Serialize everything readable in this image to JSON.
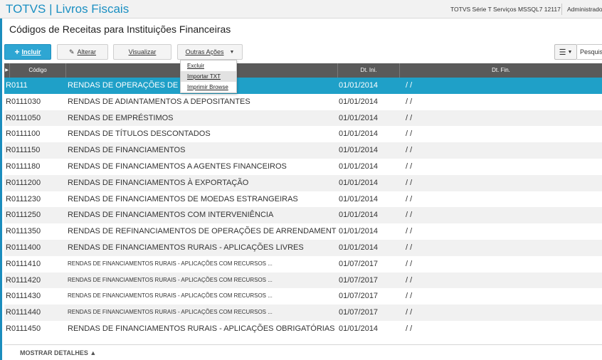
{
  "app": {
    "brand": "TOTVS | Livros Fiscais",
    "server": "TOTVS Série T Serviços MSSQL7 12117",
    "user": "Administrado"
  },
  "page": {
    "title": "Códigos de Receitas para Instituições Financeiras"
  },
  "toolbar": {
    "incluir": "Incluir",
    "alterar": "Alterar",
    "visualizar": "Visualizar",
    "outras": "Outras Ações",
    "search_label": "Pesquisa"
  },
  "menu": {
    "items": [
      "Excluir",
      "Importar TXT",
      "Imprimir Browse"
    ],
    "highlighted": 1
  },
  "grid": {
    "columns": [
      "Código",
      "",
      "Dt. Ini.",
      "Dt. Fin."
    ],
    "rows": [
      {
        "codigo": "R0111",
        "descricao": "RENDAS DE OPERAÇÕES DE C",
        "dt_ini": "01/01/2014",
        "dt_fin": "/ /"
      },
      {
        "codigo": "R0111030",
        "descricao": "RENDAS DE ADIANTAMENTOS A DEPOSITANTES",
        "dt_ini": "01/01/2014",
        "dt_fin": "/ /"
      },
      {
        "codigo": "R0111050",
        "descricao": "RENDAS DE EMPRÉSTIMOS",
        "dt_ini": "01/01/2014",
        "dt_fin": "/ /"
      },
      {
        "codigo": "R0111100",
        "descricao": "RENDAS DE TÍTULOS DESCONTADOS",
        "dt_ini": "01/01/2014",
        "dt_fin": "/ /"
      },
      {
        "codigo": "R0111150",
        "descricao": "RENDAS DE FINANCIAMENTOS",
        "dt_ini": "01/01/2014",
        "dt_fin": "/ /"
      },
      {
        "codigo": "R0111180",
        "descricao": "RENDAS DE FINANCIAMENTOS A AGENTES FINANCEIROS",
        "dt_ini": "01/01/2014",
        "dt_fin": "/ /"
      },
      {
        "codigo": "R0111200",
        "descricao": "RENDAS DE FINANCIAMENTOS À EXPORTAÇÃO",
        "dt_ini": "01/01/2014",
        "dt_fin": "/ /"
      },
      {
        "codigo": "R0111230",
        "descricao": "RENDAS DE FINANCIAMENTOS DE MOEDAS ESTRANGEIRAS",
        "dt_ini": "01/01/2014",
        "dt_fin": "/ /"
      },
      {
        "codigo": "R0111250",
        "descricao": "RENDAS DE FINANCIAMENTOS COM INTERVENIÊNCIA",
        "dt_ini": "01/01/2014",
        "dt_fin": "/ /"
      },
      {
        "codigo": "R0111350",
        "descricao": "RENDAS DE REFINANCIAMENTOS DE OPERAÇÕES DE ARRENDAMENTO",
        "dt_ini": "01/01/2014",
        "dt_fin": "/ /"
      },
      {
        "codigo": "R0111400",
        "descricao": "RENDAS DE FINANCIAMENTOS RURAIS - APLICAÇÕES LIVRES",
        "dt_ini": "01/01/2014",
        "dt_fin": "/ /"
      },
      {
        "codigo": "R0111410",
        "descricao": "RENDAS DE FINANCIAMENTOS RURAIS - APLICAÇÕES COM RECURSOS ...",
        "dt_ini": "01/07/2017",
        "dt_fin": "/ /"
      },
      {
        "codigo": "R0111420",
        "descricao": "RENDAS DE FINANCIAMENTOS RURAIS - APLICAÇÕES COM RECURSOS ...",
        "dt_ini": "01/07/2017",
        "dt_fin": "/ /"
      },
      {
        "codigo": "R0111430",
        "descricao": "RENDAS DE FINANCIAMENTOS RURAIS - APLICAÇÕES COM RECURSOS ...",
        "dt_ini": "01/07/2017",
        "dt_fin": "/ /"
      },
      {
        "codigo": "R0111440",
        "descricao": "RENDAS DE FINANCIAMENTOS RURAIS - APLICAÇÕES COM RECURSOS ...",
        "dt_ini": "01/07/2017",
        "dt_fin": "/ /"
      },
      {
        "codigo": "R0111450",
        "descricao": "RENDAS DE FINANCIAMENTOS RURAIS - APLICAÇÕES OBRIGATÓRIAS",
        "dt_ini": "01/01/2014",
        "dt_fin": "/ /"
      }
    ],
    "selected_index": 0
  },
  "footer": {
    "details": "MOSTRAR DETALHES ▲"
  },
  "colors": {
    "accent": "#2ea6d3",
    "selected": "#1fa0c8",
    "header": "#5a5a5a"
  }
}
